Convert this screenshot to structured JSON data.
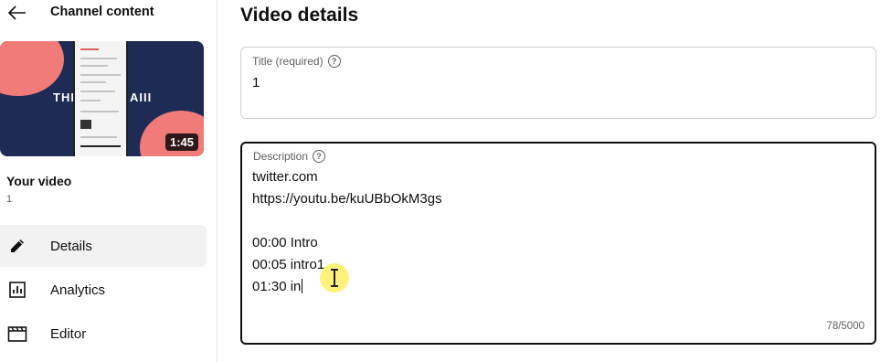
{
  "sidebar": {
    "back_title": "Channel content",
    "thumbnail": {
      "overlay_left": "THR",
      "overlay_right": "AIII",
      "duration": "1:45"
    },
    "your_video_label": "Your video",
    "your_video_value": "1",
    "items": [
      {
        "label": "Details",
        "icon": "pencil-icon",
        "active": true
      },
      {
        "label": "Analytics",
        "icon": "analytics-icon",
        "active": false
      },
      {
        "label": "Editor",
        "icon": "clapperboard-icon",
        "active": false
      }
    ]
  },
  "main": {
    "page_title": "Video details",
    "title_field": {
      "label": "Title (required)",
      "value": "1"
    },
    "description_field": {
      "label": "Description",
      "lines": [
        "twitter.com",
        "https://youtu.be/kuUBbOkM3gs",
        "",
        "00:00 Intro",
        "00:05 intro1",
        "01:30 in"
      ],
      "char_count": "78/5000"
    }
  },
  "colors": {
    "text": "#0f0f0f",
    "secondary_text": "#606060",
    "active_nav_bg": "#f2f2f2",
    "thumb_navy": "#1d2b55",
    "thumb_coral": "#f07b78",
    "cursor_highlight": "#ffee50"
  }
}
